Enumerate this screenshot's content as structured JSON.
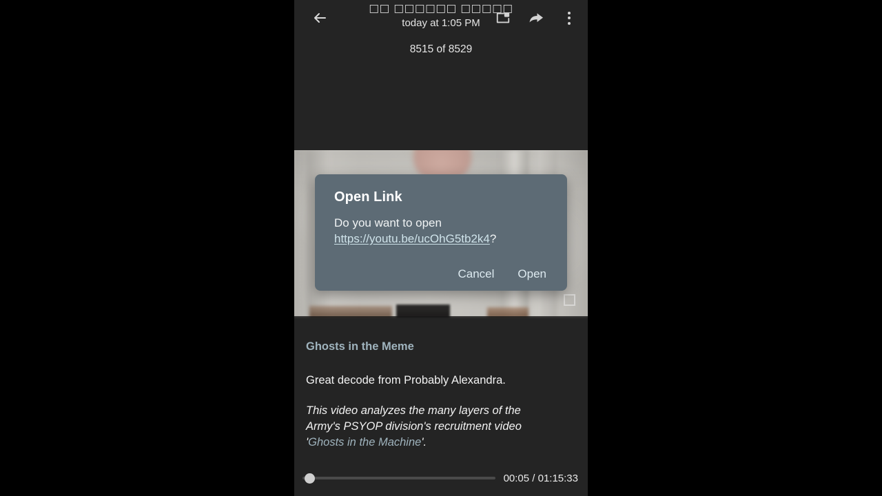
{
  "app_bar": {
    "back_icon": "arrow-back-icon",
    "title": "□□ □□□□□□ □□□□□",
    "subtitle": "today at 1:05 PM",
    "pip_icon": "picture-in-picture-icon",
    "share_icon": "share-forward-icon",
    "overflow_icon": "more-vertical-icon"
  },
  "counter": {
    "label": "8515 of 8529"
  },
  "video": {
    "fullscreen_icon": "fullscreen-expand-icon"
  },
  "dialog": {
    "title": "Open Link",
    "message_prefix": "Do you want to open ",
    "link_text": "https://youtu.be/ucOhG5tb2k4",
    "message_suffix": "?",
    "cancel_label": "Cancel",
    "open_label": "Open"
  },
  "caption": {
    "title": "Ghosts in the Meme",
    "body": "Great decode from Probably Alexandra.",
    "italic_prefix": "This video analyzes the many layers of the Army's PSYOP division's recruitment video '",
    "italic_link": "Ghosts in the Machine",
    "italic_suffix": "'."
  },
  "player": {
    "current_time": "00:05",
    "duration": "01:15:33",
    "time_display": "00:05 / 01:15:33"
  },
  "colors": {
    "background": "#242424",
    "letterbox": "#000000",
    "dialog_bg": "#5d6b75",
    "link": "#9fb3bd",
    "dialog_link": "#cfe3ea",
    "text": "#f2f2f2"
  }
}
